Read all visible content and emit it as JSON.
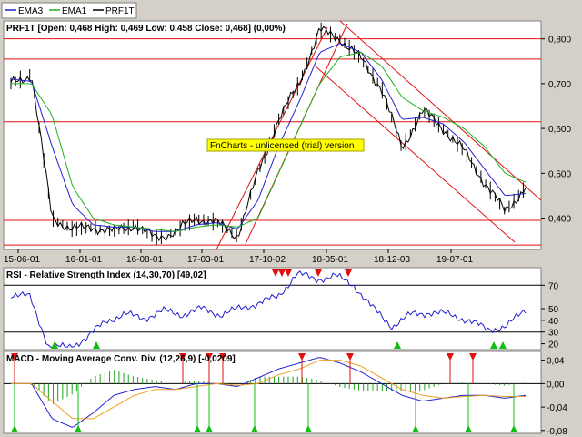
{
  "legend": [
    {
      "name": "EMA3",
      "color": "#2020d0"
    },
    {
      "name": "EMA1",
      "color": "#20b020"
    },
    {
      "name": "PRF1T",
      "color": "#000000"
    }
  ],
  "price_panel": {
    "title": "PRF1T [Open: 0,468  High: 0,469  Low: 0,458  Close: 0,468] (0,00%)",
    "watermark": "FnCharts - unlicensed (trial) version",
    "y_ticks": [
      "0,800",
      "0,700",
      "0,600",
      "0,500",
      "0,400"
    ],
    "x_ticks": [
      "15-06-01",
      "16-01-01",
      "16-08-01",
      "17-03-01",
      "17-10-02",
      "18-05-01",
      "18-12-03",
      "19-07-01"
    ]
  },
  "rsi_panel": {
    "title": "RSI - Relative Strength Index (14,30,70) [49,02]",
    "y_ticks": [
      "70",
      "50",
      "40",
      "30",
      "20"
    ]
  },
  "macd_panel": {
    "title": "MACD - Moving Average Conv. Div. (12,26,9) [-0,0209]",
    "y_ticks": [
      "0,04",
      "0,00",
      "-0,04",
      "-0,08"
    ]
  },
  "colors": {
    "background": "#ffffff",
    "frame": "#d4d0c8",
    "price": "#000000",
    "ema3": "#2020d0",
    "ema1": "#20b020",
    "macd_signal": "#f0a020",
    "hist": "#20a020",
    "sell": "#e01010",
    "buy": "#10c010",
    "support_line": "#e01010",
    "watermark_bg": "#ffff00"
  },
  "chart_data": [
    {
      "type": "line",
      "title": "PRF1T [Open: 0,468  High: 0,469  Low: 0,458  Close: 0,468] (0,00%)",
      "x": [
        "15-06-01",
        "16-01-01",
        "16-08-01",
        "17-03-01",
        "17-10-02",
        "18-05-01",
        "18-12-03",
        "19-07-01"
      ],
      "ylim": [
        0.33,
        0.84
      ],
      "horizontal_lines": [
        0.8,
        0.755,
        0.615,
        0.395,
        0.34
      ],
      "series": [
        {
          "name": "PRF1T",
          "values": [
            0.7,
            0.72,
            0.4,
            0.375,
            0.38,
            0.37,
            0.385,
            0.355,
            0.37,
            0.4,
            0.39,
            0.36,
            0.5,
            0.62,
            0.7,
            0.82,
            0.8,
            0.755,
            0.69,
            0.555,
            0.64,
            0.6,
            0.55,
            0.48,
            0.415,
            0.468
          ]
        },
        {
          "name": "EMA3",
          "values": [
            0.71,
            0.705,
            0.56,
            0.43,
            0.385,
            0.38,
            0.38,
            0.37,
            0.37,
            0.385,
            0.39,
            0.375,
            0.44,
            0.56,
            0.66,
            0.77,
            0.79,
            0.77,
            0.71,
            0.62,
            0.625,
            0.61,
            0.57,
            0.51,
            0.45,
            0.455
          ]
        },
        {
          "name": "EMA1",
          "values": [
            0.7,
            0.7,
            0.63,
            0.47,
            0.4,
            0.385,
            0.38,
            0.375,
            0.37,
            0.38,
            0.385,
            0.38,
            0.4,
            0.5,
            0.6,
            0.7,
            0.76,
            0.77,
            0.74,
            0.67,
            0.64,
            0.625,
            0.6,
            0.56,
            0.5,
            0.48
          ]
        }
      ]
    },
    {
      "type": "line",
      "title": "RSI - Relative Strength Index (14,30,70) [49,02]",
      "ylim": [
        15,
        85
      ],
      "thresholds": [
        70,
        30
      ],
      "series": [
        {
          "name": "RSI",
          "values": [
            62,
            60,
            17,
            17,
            25,
            40,
            45,
            42,
            48,
            45,
            50,
            45,
            50,
            55,
            60,
            80,
            75,
            78,
            70,
            50,
            35,
            45,
            47,
            45,
            40,
            32,
            35,
            49
          ]
        }
      ]
    },
    {
      "type": "bar",
      "title": "MACD - Moving Average Conv. Div. (12,26,9) [-0,0209]",
      "ylim": [
        -0.085,
        0.055
      ],
      "series": [
        {
          "name": "MACD",
          "values": [
            0.0,
            0.0,
            -0.06,
            -0.075,
            -0.05,
            -0.02,
            -0.01,
            -0.005,
            -0.01,
            0.0,
            0.0,
            -0.005,
            0.01,
            0.025,
            0.035,
            0.045,
            0.035,
            0.02,
            0.0,
            -0.02,
            -0.03,
            -0.025,
            -0.02,
            -0.02,
            -0.025,
            -0.02
          ]
        },
        {
          "name": "Signal",
          "values": [
            0.0,
            0.0,
            -0.03,
            -0.06,
            -0.06,
            -0.04,
            -0.02,
            -0.01,
            -0.01,
            -0.005,
            0.0,
            -0.003,
            0.0,
            0.015,
            0.025,
            0.04,
            0.04,
            0.03,
            0.01,
            -0.01,
            -0.02,
            -0.025,
            -0.022,
            -0.02,
            -0.022,
            -0.022
          ]
        }
      ]
    }
  ]
}
